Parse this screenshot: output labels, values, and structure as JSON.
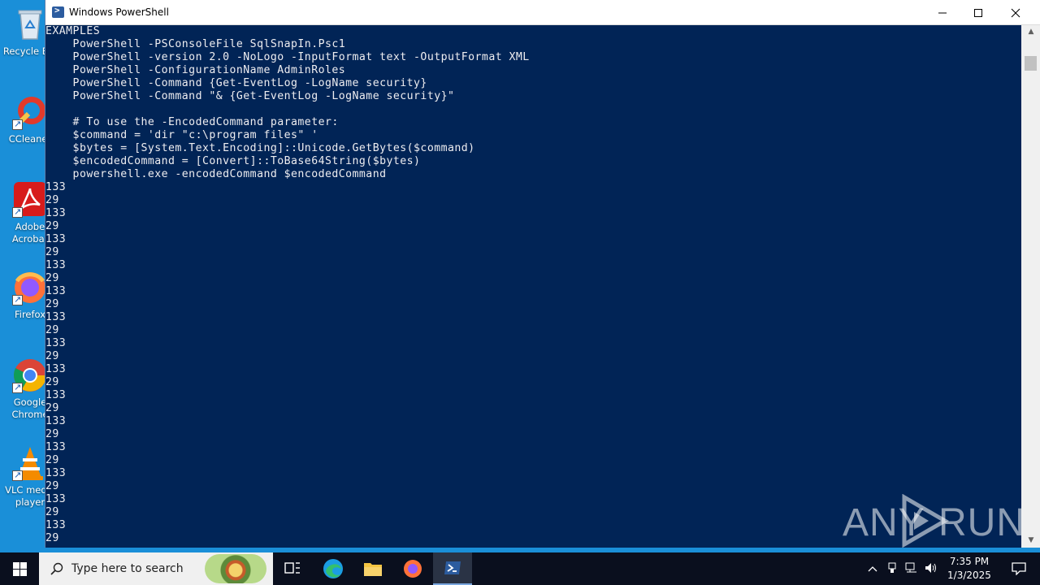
{
  "window": {
    "title": "Windows PowerShell",
    "minimize_label": "Minimize",
    "maximize_label": "Maximize",
    "close_label": "Close"
  },
  "console": {
    "lines": [
      "EXAMPLES",
      "    PowerShell -PSConsoleFile SqlSnapIn.Psc1",
      "    PowerShell -version 2.0 -NoLogo -InputFormat text -OutputFormat XML",
      "    PowerShell -ConfigurationName AdminRoles",
      "    PowerShell -Command {Get-EventLog -LogName security}",
      "    PowerShell -Command \"& {Get-EventLog -LogName security}\"",
      "",
      "    # To use the -EncodedCommand parameter:",
      "    $command = 'dir \"c:\\program files\" '",
      "    $bytes = [System.Text.Encoding]::Unicode.GetBytes($command)",
      "    $encodedCommand = [Convert]::ToBase64String($bytes)",
      "    powershell.exe -encodedCommand $encodedCommand",
      "133",
      "29",
      "133",
      "29",
      "133",
      "29",
      "133",
      "29",
      "133",
      "29",
      "133",
      "29",
      "133",
      "29",
      "133",
      "29",
      "133",
      "29",
      "133",
      "29",
      "133",
      "29",
      "133",
      "29",
      "133",
      "29",
      "133",
      "29"
    ]
  },
  "desktop": {
    "icons": [
      {
        "name": "recycle-bin",
        "label": "Recycle Bin"
      },
      {
        "name": "ccleaner",
        "label": "CCleaner"
      },
      {
        "name": "adobe-acrobat",
        "label": "Adobe\nAcrobat"
      },
      {
        "name": "firefox",
        "label": "Firefox"
      },
      {
        "name": "google-chrome",
        "label": "Google\nChrome"
      },
      {
        "name": "vlc",
        "label": "VLC media\nplayer"
      }
    ]
  },
  "taskbar": {
    "search_placeholder": "Type here to search",
    "time": "7:35 PM",
    "date": "1/3/2025"
  },
  "watermark": {
    "text_left": "ANY",
    "text_right": "RUN"
  },
  "colors": {
    "console_bg": "#012456",
    "console_fg": "#eeedf0",
    "desktop_bg": "#1a8fd8",
    "taskbar_bg": "#0a0f1e"
  }
}
